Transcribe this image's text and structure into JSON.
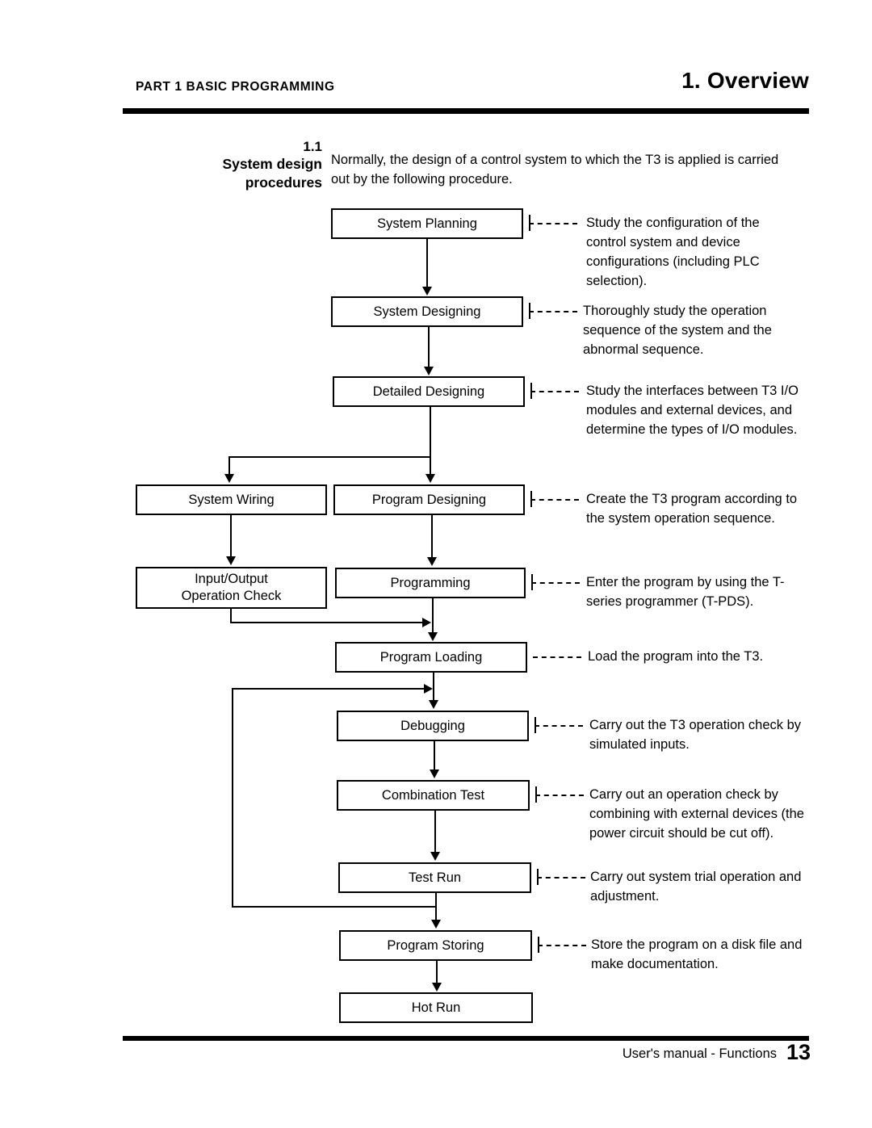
{
  "header": {
    "left": "PART 1  BASIC  PROGRAMMING",
    "right": "1. Overview"
  },
  "section": {
    "number": "1.1",
    "title": "System design\nprocedures",
    "intro": "Normally, the design of a control system to which the T3 is applied is carried out by the following procedure."
  },
  "flowchart": {
    "nodes": [
      {
        "id": "system-planning",
        "label": "System Planning"
      },
      {
        "id": "system-designing",
        "label": "System Designing"
      },
      {
        "id": "detailed-designing",
        "label": "Detailed Designing"
      },
      {
        "id": "system-wiring",
        "label": "System Wiring"
      },
      {
        "id": "program-designing",
        "label": "Program Designing"
      },
      {
        "id": "io-operation-check",
        "label": "Input/Output\nOperation Check"
      },
      {
        "id": "programming",
        "label": "Programming"
      },
      {
        "id": "program-loading",
        "label": "Program Loading"
      },
      {
        "id": "debugging",
        "label": "Debugging"
      },
      {
        "id": "combination-test",
        "label": "Combination Test"
      },
      {
        "id": "test-run",
        "label": "Test Run"
      },
      {
        "id": "program-storing",
        "label": "Program Storing"
      },
      {
        "id": "hot-run",
        "label": "Hot Run"
      }
    ],
    "notes": [
      {
        "for": "system-planning",
        "text": "Study the configuration of the control system and device configurations (including PLC selection)."
      },
      {
        "for": "system-designing",
        "text": "Thoroughly study the operation sequence of the system and the abnormal sequence."
      },
      {
        "for": "detailed-designing",
        "text": "Study the interfaces between T3 I/O modules and external devices, and determine the types of I/O modules."
      },
      {
        "for": "program-designing",
        "text": "Create the T3 program according to the system operation sequence."
      },
      {
        "for": "programming",
        "text": "Enter the program by using the T-series programmer (T-PDS)."
      },
      {
        "for": "program-loading",
        "text": "Load the program into the T3."
      },
      {
        "for": "debugging",
        "text": "Carry out the T3 operation check by simulated inputs."
      },
      {
        "for": "combination-test",
        "text": "Carry out an operation check by combining with external devices (the power circuit should be cut off)."
      },
      {
        "for": "test-run",
        "text": "Carry out system trial operation and adjustment."
      },
      {
        "for": "program-storing",
        "text": "Store the program on a disk file and make documentation."
      }
    ]
  },
  "footer": {
    "text": "User's manual - Functions",
    "page": "13"
  }
}
